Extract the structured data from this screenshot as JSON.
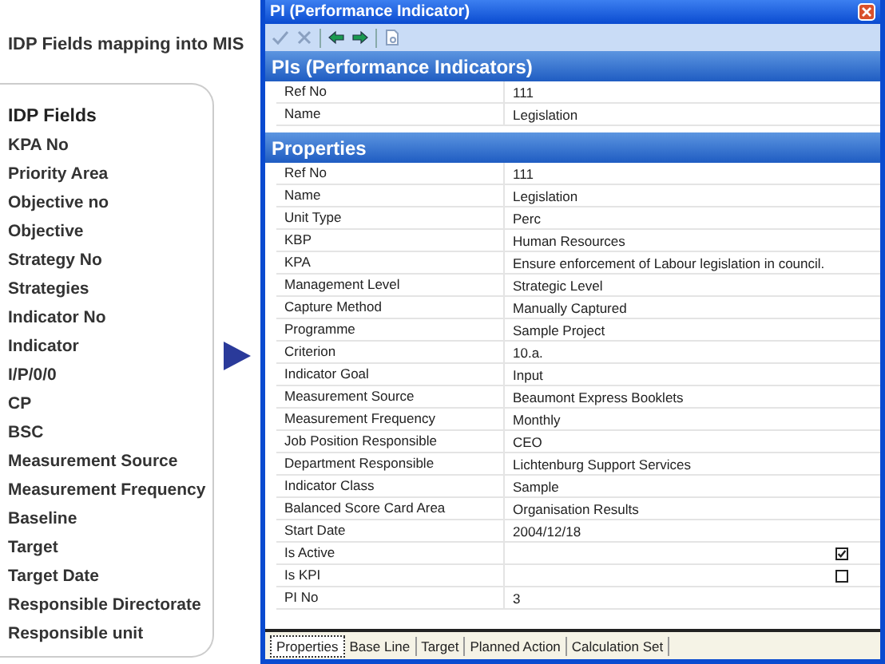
{
  "caption": "IDP Fields mapping into MIS",
  "idp_fields": {
    "heading": "IDP Fields",
    "items": [
      "KPA No",
      "Priority Area",
      "Objective no",
      "Objective",
      "Strategy No",
      "Strategies",
      "Indicator No",
      "Indicator",
      "I/P/0/0",
      "CP",
      "BSC",
      "Measurement Source",
      "Measurement Frequency",
      "Baseline",
      "Target",
      "Target Date",
      "Responsible Directorate",
      "Responsible unit"
    ]
  },
  "window": {
    "title": "PI (Performance Indicator)"
  },
  "pis_section": {
    "title": "PIs (Performance Indicators)",
    "rows": [
      {
        "label": "Ref No",
        "value": "111"
      },
      {
        "label": "Name",
        "value": "Legislation"
      }
    ]
  },
  "properties_section": {
    "title": "Properties",
    "rows": [
      {
        "kind": "text",
        "label": "Ref No",
        "value": "111"
      },
      {
        "kind": "text",
        "label": "Name",
        "value": "Legislation"
      },
      {
        "kind": "text",
        "label": "Unit Type",
        "value": "Perc"
      },
      {
        "kind": "text",
        "label": "KBP",
        "value": "Human Resources"
      },
      {
        "kind": "text",
        "label": "KPA",
        "value": "Ensure enforcement of Labour legislation in council."
      },
      {
        "kind": "text",
        "label": "Management Level",
        "value": "Strategic Level"
      },
      {
        "kind": "text",
        "label": "Capture Method",
        "value": "Manually Captured"
      },
      {
        "kind": "text",
        "label": "Programme",
        "value": "Sample Project"
      },
      {
        "kind": "text",
        "label": "Criterion",
        "value": "10.a."
      },
      {
        "kind": "text",
        "label": "Indicator Goal",
        "value": "Input"
      },
      {
        "kind": "text",
        "label": "Measurement Source",
        "value": "Beaumont Express Booklets"
      },
      {
        "kind": "text",
        "label": "Measurement Frequency",
        "value": "Monthly"
      },
      {
        "kind": "text",
        "label": "Job Position Responsible",
        "value": "CEO"
      },
      {
        "kind": "text",
        "label": "Department Responsible",
        "value": "Lichtenburg Support Services"
      },
      {
        "kind": "text",
        "label": "Indicator Class",
        "value": "Sample"
      },
      {
        "kind": "text",
        "label": "Balanced Score Card Area",
        "value": "Organisation Results"
      },
      {
        "kind": "text",
        "label": "Start Date",
        "value": "2004/12/18"
      },
      {
        "kind": "check",
        "label": "Is Active",
        "checked": true
      },
      {
        "kind": "check",
        "label": "Is KPI",
        "checked": false
      },
      {
        "kind": "text",
        "label": "PI No",
        "value": "3"
      }
    ]
  },
  "tabs": [
    {
      "label": "Properties",
      "selected": true
    },
    {
      "label": "Base Line",
      "selected": false
    },
    {
      "label": "Target",
      "selected": false
    },
    {
      "label": "Planned Action",
      "selected": false
    },
    {
      "label": "Calculation Set",
      "selected": false
    }
  ]
}
